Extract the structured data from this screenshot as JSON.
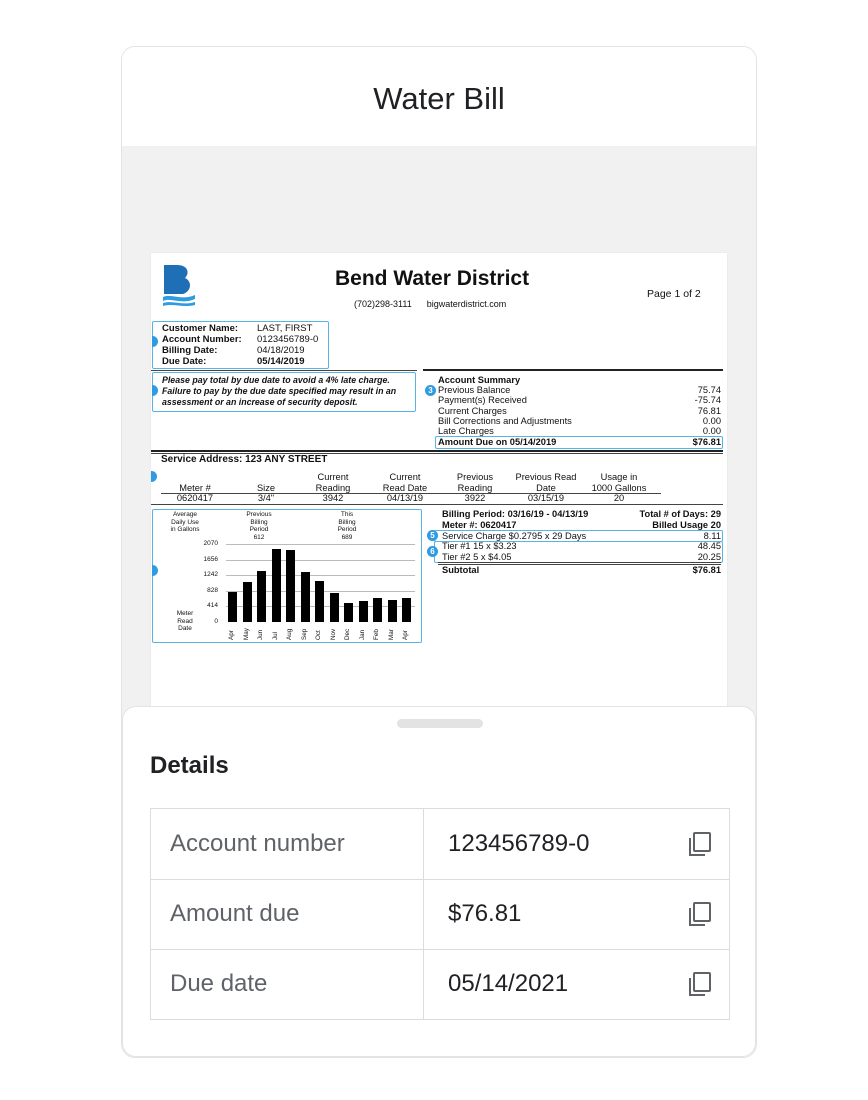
{
  "card": {
    "title": "Water Bill"
  },
  "bill": {
    "district": "Bend Water District",
    "phone": "(702)298-3111",
    "website": "bigwaterdistrict.com",
    "page": "Page 1 of 2",
    "customer": {
      "labels": [
        "Customer Name:",
        "Account Number:",
        "Billing Date:",
        "Due Date:"
      ],
      "values": [
        "LAST, FIRST",
        "0123456789-0",
        "04/18/2019",
        "05/14/2019"
      ]
    },
    "late_notice": [
      "Please pay total by due date to avoid a 4% late charge.",
      "Failure to pay by the due date specified may result in an",
      "assessment or an increase of security deposit."
    ],
    "account_summary": {
      "title": "Account Summary",
      "badge": "3",
      "rows": [
        {
          "label": "Previous Balance",
          "value": "75.74"
        },
        {
          "label": "Payment(s) Received",
          "value": "-75.74"
        },
        {
          "label": "Current Charges",
          "value": "76.81"
        },
        {
          "label": "Bill Corrections and Adjustments",
          "value": "0.00"
        },
        {
          "label": "Late Charges",
          "value": "0.00"
        }
      ],
      "amount_due_label": "Amount Due on 05/14/2019",
      "amount_due_value": "$76.81"
    },
    "service": {
      "address": "Service Address: 123 ANY STREET",
      "headers_top": [
        "",
        "",
        "Current",
        "Current",
        "Previous",
        "Previous Read",
        "Usage in"
      ],
      "headers_bottom": [
        "Meter #",
        "Size",
        "Reading",
        "Read Date",
        "Reading",
        "Date",
        "1000 Gallons"
      ],
      "values": [
        "0620417",
        "3/4\"",
        "3942",
        "04/13/19",
        "3922",
        "03/15/19",
        "20"
      ]
    },
    "usage_chart": {
      "avg_label": [
        "Average",
        "Daily Use",
        "in Gallons"
      ],
      "prev_label": [
        "Previous",
        "Billing",
        "Period",
        "612"
      ],
      "this_label": [
        "This",
        "Billing",
        "Period",
        "689"
      ],
      "meter_label": [
        "Meter",
        "Read",
        "Date"
      ]
    },
    "billing": {
      "period": "Billing Period: 03/16/19 - 04/13/19",
      "days": "Total # of Days: 29",
      "meter": "Meter #: 0620417",
      "billed": "Billed Usage 20",
      "rows": [
        {
          "badge": "5",
          "label": "Service Charge $0.2795 x 29 Days",
          "value": "8.11"
        },
        {
          "badge": "6",
          "label": "Tier #1 15 x $3.23",
          "value": "48.45"
        },
        {
          "badge": "",
          "label": "Tier #2 5 x $4.05",
          "value": "20.25"
        }
      ],
      "subtotal_label": "Subtotal",
      "subtotal_value": "$76.81"
    }
  },
  "chart_data": {
    "type": "bar",
    "categories": [
      "Apr",
      "May",
      "Jun",
      "Jul",
      "Aug",
      "Sep",
      "Oct",
      "Nov",
      "Dec",
      "Jan",
      "Feb",
      "Mar",
      "Apr"
    ],
    "values": [
      800,
      1050,
      1350,
      1950,
      1900,
      1340,
      1080,
      760,
      510,
      560,
      650,
      590,
      650
    ],
    "yticks": [
      0,
      414,
      828,
      1242,
      1656,
      2070
    ],
    "ylim": [
      0,
      2070
    ],
    "xlabel": "",
    "ylabel": "",
    "title": ""
  },
  "details": {
    "title": "Details",
    "rows": [
      {
        "label": "Account number",
        "value": "123456789-0"
      },
      {
        "label": "Amount due",
        "value": "$76.81"
      },
      {
        "label": "Due date",
        "value": "05/14/2021"
      }
    ]
  },
  "colors": {
    "accent_blue": "#2f9be0",
    "box_blue": "#59b4e5",
    "logo_blue": "#1f6fb6"
  },
  "icons": {
    "copy": "copy-icon"
  }
}
